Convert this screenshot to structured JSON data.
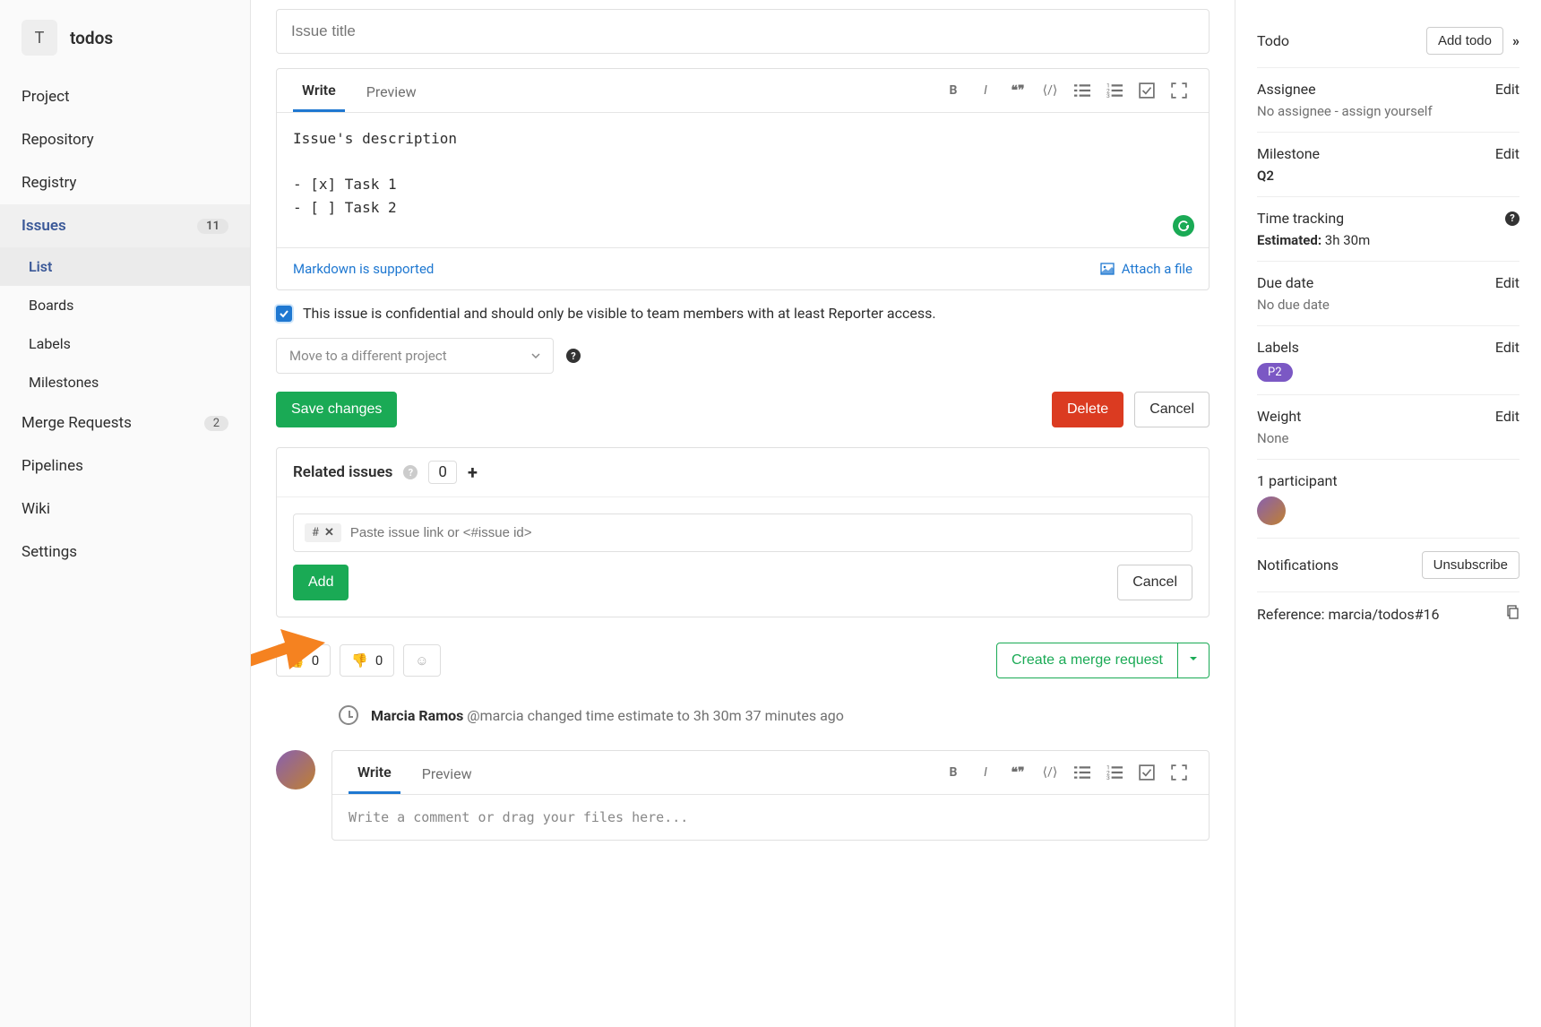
{
  "sidebar": {
    "avatar_letter": "T",
    "project_name": "todos",
    "items": [
      {
        "label": "Project"
      },
      {
        "label": "Repository"
      },
      {
        "label": "Registry"
      },
      {
        "label": "Issues",
        "count": "11",
        "active": true,
        "subs": [
          {
            "label": "List",
            "active": true
          },
          {
            "label": "Boards"
          },
          {
            "label": "Labels"
          },
          {
            "label": "Milestones"
          }
        ]
      },
      {
        "label": "Merge Requests",
        "count": "2"
      },
      {
        "label": "Pipelines"
      },
      {
        "label": "Wiki"
      },
      {
        "label": "Settings"
      }
    ]
  },
  "editor": {
    "title_placeholder": "Issue title",
    "tabs": {
      "write": "Write",
      "preview": "Preview"
    },
    "body": "Issue's description\n\n- [x] Task 1\n- [ ] Task 2",
    "body_lines": [
      "Issue's description",
      "",
      "- [x] Task 1",
      "- [ ] Task 2"
    ],
    "markdown_link": "Markdown is supported",
    "attach_label": "Attach a file"
  },
  "confidential_text": "This issue is confidential and should only be visible to team members with at least Reporter access.",
  "move_placeholder": "Move to a different project",
  "buttons": {
    "save": "Save changes",
    "delete": "Delete",
    "cancel": "Cancel",
    "add": "Add",
    "create_mr": "Create a merge request",
    "add_todo": "Add todo",
    "unsubscribe": "Unsubscribe",
    "edit": "Edit"
  },
  "related": {
    "heading": "Related issues",
    "count": "0",
    "placeholder": "Paste issue link or <#issue id>",
    "tag": "#"
  },
  "reactions": {
    "thumbs_up_count": "0",
    "thumbs_down_count": "0"
  },
  "activity": {
    "author": "Marcia Ramos",
    "handle": "@marcia",
    "text": "changed time estimate to 3h 30m",
    "time": "37 minutes ago"
  },
  "comment": {
    "tabs": {
      "write": "Write",
      "preview": "Preview"
    },
    "placeholder": "Write a comment or drag your files here..."
  },
  "rail": {
    "todo_label": "Todo",
    "assignee": {
      "label": "Assignee",
      "value": "No assignee -",
      "link": "assign yourself"
    },
    "milestone": {
      "label": "Milestone",
      "value": "Q2"
    },
    "time": {
      "label": "Time tracking",
      "estimated_label": "Estimated:",
      "estimated_value": "3h 30m"
    },
    "due": {
      "label": "Due date",
      "value": "No due date"
    },
    "labels": {
      "label": "Labels",
      "chip": "P2"
    },
    "weight": {
      "label": "Weight",
      "value": "None"
    },
    "participants": {
      "label": "1 participant"
    },
    "notifications": {
      "label": "Notifications"
    },
    "reference": {
      "label": "Reference:",
      "value": "marcia/todos#16"
    }
  }
}
